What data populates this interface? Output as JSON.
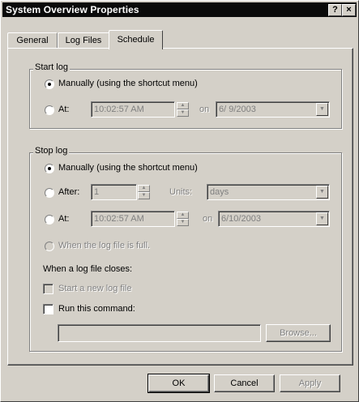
{
  "window": {
    "title": "System Overview Properties",
    "help_glyph": "?",
    "close_glyph": "×"
  },
  "tabs": [
    {
      "label": "General"
    },
    {
      "label": "Log Files"
    },
    {
      "label": "Schedule"
    }
  ],
  "start_log": {
    "legend": "Start log",
    "manually_label": "Manually (using the shortcut menu)",
    "at_label": "At:",
    "time_value": "10:02:57 AM",
    "on_label": "on",
    "date_value": "6/ 9/2003"
  },
  "stop_log": {
    "legend": "Stop log",
    "manually_label": "Manually (using the shortcut menu)",
    "after_label": "After:",
    "after_value": "1",
    "units_label": "Units:",
    "units_value": "days",
    "at_label": "At:",
    "time_value": "10:02:57 AM",
    "on_label": "on",
    "date_value": "6/10/2003",
    "when_full_label": "When the log file is full.",
    "closes_heading": "When a log file closes:",
    "start_new_label": "Start a new log file",
    "run_command_label": "Run this command:",
    "command_value": "",
    "browse_label": "Browse..."
  },
  "buttons": {
    "ok": "OK",
    "cancel": "Cancel",
    "apply": "Apply"
  },
  "icons": {
    "radio_selected": "radio-selected-icon",
    "spin_up": "▲",
    "spin_down": "▼",
    "dropdown": "▼"
  }
}
